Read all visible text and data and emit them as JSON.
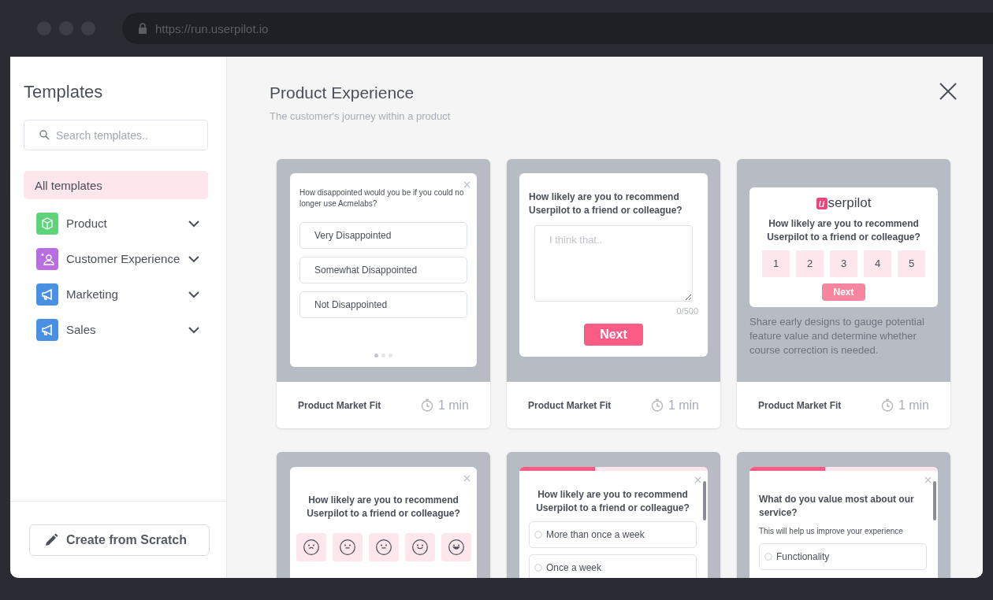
{
  "browser": {
    "url": "https://run.userpilot.io"
  },
  "sidebar": {
    "title": "Templates",
    "search": {
      "placeholder": "Search templates.."
    },
    "items": [
      {
        "label": "All templates",
        "selected": true
      },
      {
        "label": "Product",
        "selected": false,
        "expanded": false,
        "color": "#5fd37a"
      },
      {
        "label": "Customer Experience",
        "selected": false,
        "expanded": false,
        "color": "#b86ee0"
      },
      {
        "label": "Marketing",
        "selected": false,
        "expanded": false,
        "color": "#4a90e2"
      },
      {
        "label": "Sales",
        "selected": false,
        "expanded": false,
        "color": "#4a90e2"
      }
    ],
    "create_button": "Create from Scratch"
  },
  "main": {
    "title": "Product Experience",
    "subtitle": "The customer's journey within a product",
    "cards": [
      {
        "kind": "choice",
        "question": "How disappointed would you be if you could no longer use Acmelabs?",
        "options": [
          "Very Disappointed",
          "Somewhat Disappointed",
          "Not Disappointed"
        ],
        "page_dots": [
          {
            "selected": true
          },
          {
            "selected": false
          },
          {
            "selected": false
          }
        ],
        "name": "Product Market Fit",
        "duration": "1 min"
      },
      {
        "kind": "text",
        "question": "How likely are you to recommend Userpilot to a friend or colleague?",
        "placeholder": "I think that..",
        "counter": "0/500",
        "button": "Next",
        "name": "Product Market Fit",
        "duration": "1 min"
      },
      {
        "kind": "nps",
        "logo": "serpilot",
        "logo_mark": "u",
        "question": "How likely are you to recommend Userpilot to a friend or colleague?",
        "scale": [
          "1",
          "2",
          "3",
          "4",
          "5"
        ],
        "button": "Next",
        "description": "Share early designs to gauge potential feature value and determine whether course correction is needed.",
        "name": "Product Market Fit",
        "duration": "1 min"
      },
      {
        "kind": "emoji",
        "question": "How likely are you to recommend Userpilot to a friend or colleague?"
      },
      {
        "kind": "radio",
        "progress": {
          "level": 0.4
        },
        "question": "How likely are you to recommend Userpilot to a friend or colleague?",
        "options": [
          "More than once a week",
          "Once a week"
        ]
      },
      {
        "kind": "radio",
        "progress": {
          "level": 0.4
        },
        "question": "What do you value most about our service?",
        "note": "This will help us improve your experience",
        "options": [
          "Functionality"
        ]
      }
    ]
  }
}
